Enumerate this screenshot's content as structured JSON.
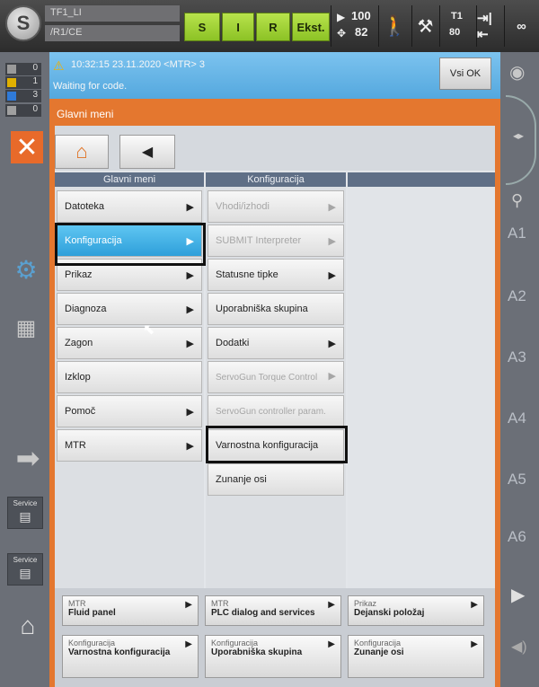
{
  "topbar": {
    "robot_name": "TF1_LI",
    "robot_path": "/R1/CE",
    "modes": [
      "S",
      "I",
      "R",
      "Ekst."
    ],
    "speed_override": "100",
    "jog_override": "82",
    "op_mode": "T1",
    "op_mode_sub": "80",
    "infinity": "∞"
  },
  "left": {
    "counters": [
      "0",
      "1",
      "3",
      "0"
    ],
    "service_label": "Service"
  },
  "message": {
    "header": "10:32:15 23.11.2020 <MTR> 3",
    "text": "Waiting for code.",
    "ok_all": "Vsi OK"
  },
  "panel": {
    "title": "Glavni meni",
    "col_main_header": "Glavni meni",
    "col_config_header": "Konfiguracija",
    "main_items": [
      {
        "label": "Datoteka"
      },
      {
        "label": "Konfiguracija"
      },
      {
        "label": "Prikaz"
      },
      {
        "label": "Diagnoza"
      },
      {
        "label": "Zagon"
      },
      {
        "label": "Izklop"
      },
      {
        "label": "Pomoč"
      },
      {
        "label": "MTR"
      }
    ],
    "config_items": [
      {
        "label": "Vhodi/izhodi"
      },
      {
        "label": "SUBMIT Interpreter"
      },
      {
        "label": "Statusne tipke"
      },
      {
        "label": "Uporabniška skupina"
      },
      {
        "label": "Dodatki"
      },
      {
        "label": "ServoGun Torque Control"
      },
      {
        "label": "ServoGun controller param."
      },
      {
        "label": "Varnostna konfiguracija"
      },
      {
        "label": "Zunanje osi"
      }
    ]
  },
  "softkeys": [
    {
      "top": "MTR",
      "bottom": "Fluid panel"
    },
    {
      "top": "MTR",
      "bottom": "PLC dialog and services"
    },
    {
      "top": "Prikaz",
      "bottom": "Dejanski položaj"
    },
    {
      "top": "Konfiguracija",
      "bottom": "Varnostna konfiguracija"
    },
    {
      "top": "Konfiguracija",
      "bottom": "Uporabniška skupina"
    },
    {
      "top": "Konfiguracija",
      "bottom": "Zunanje osi"
    }
  ],
  "axes": [
    "A1",
    "A2",
    "A3",
    "A4",
    "A5",
    "A6"
  ],
  "colors": {
    "accent_orange": "#e4772f",
    "selection_blue": "#2e9fda",
    "mode_green": "#8cc225",
    "message_blue": "#54a8de"
  },
  "icons": {
    "home": "home-icon",
    "back": "back-arrow-icon",
    "warning": "warning-icon",
    "close": "close-icon"
  }
}
